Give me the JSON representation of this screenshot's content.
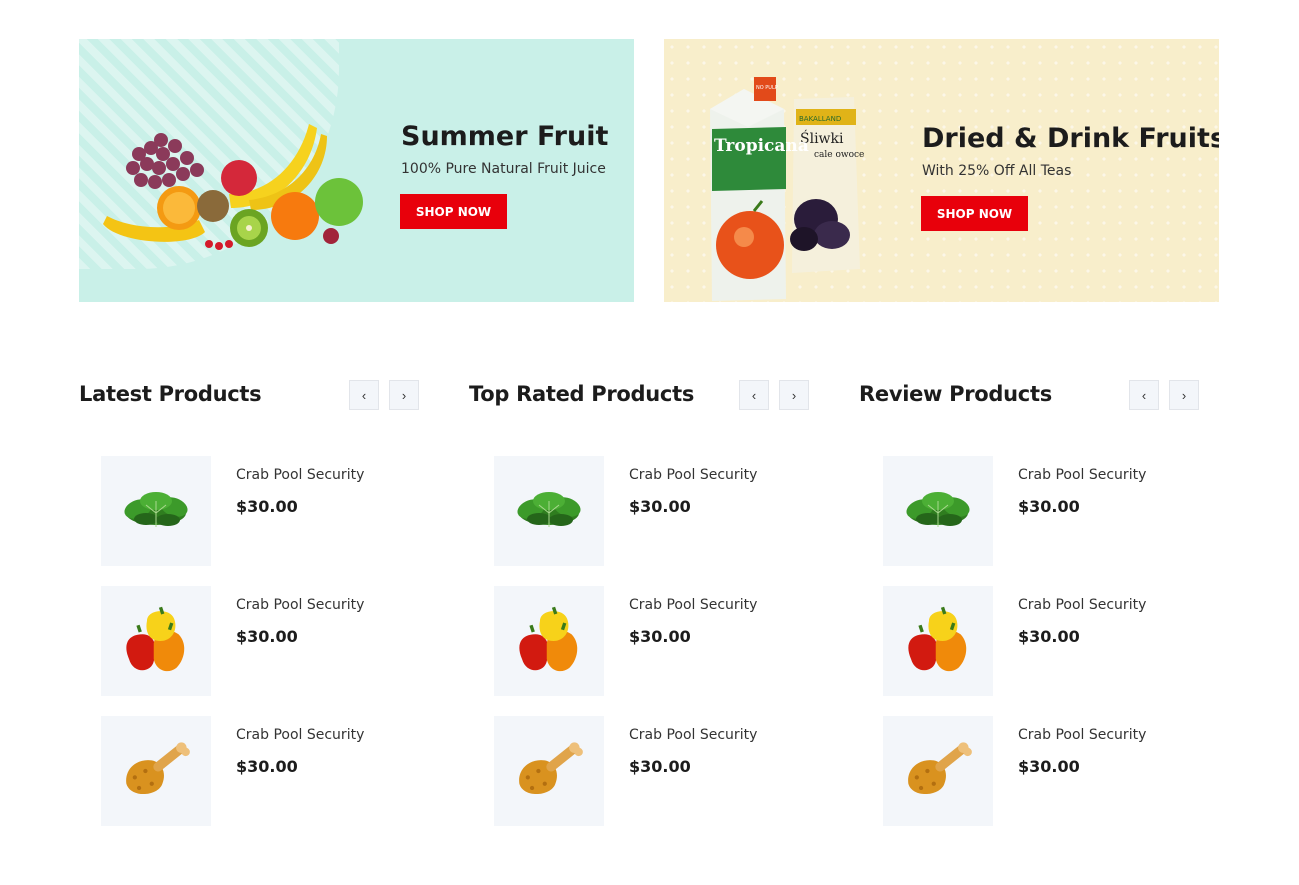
{
  "banners": [
    {
      "title": "Summer Fruit",
      "subtitle": "100% Pure Natural Fruit Juice",
      "button": "SHOP NOW",
      "image": "fruit-basket-image",
      "background": "#c9f0e8"
    },
    {
      "title": "Dried & Drink Fruits",
      "subtitle": "With 25% Off All Teas",
      "button": "SHOP NOW",
      "image": "juice-and-dried-fruit-image",
      "background": "#f8eecb",
      "package_text": {
        "juice_brand": "Tropicana",
        "juice_cap": "NO PULP",
        "bag_brand": "BAKALLAND",
        "bag_title": "Śliwki",
        "bag_sub": "cale owoce"
      }
    }
  ],
  "colors": {
    "accent": "#e8000b",
    "thumb_bg": "#f3f6fa",
    "text": "#1c1c1c"
  },
  "columns": [
    {
      "title": "Latest Products",
      "prev": "‹",
      "next": "›",
      "items": [
        {
          "name": "Crab Pool Security",
          "price": "$30.00",
          "image": "spinach-image"
        },
        {
          "name": "Crab Pool Security",
          "price": "$30.00",
          "image": "bell-peppers-image"
        },
        {
          "name": "Crab Pool Security",
          "price": "$30.00",
          "image": "fried-chicken-image"
        }
      ]
    },
    {
      "title": "Top Rated Products",
      "prev": "‹",
      "next": "›",
      "items": [
        {
          "name": "Crab Pool Security",
          "price": "$30.00",
          "image": "spinach-image"
        },
        {
          "name": "Crab Pool Security",
          "price": "$30.00",
          "image": "bell-peppers-image"
        },
        {
          "name": "Crab Pool Security",
          "price": "$30.00",
          "image": "fried-chicken-image"
        }
      ]
    },
    {
      "title": "Review Products",
      "prev": "‹",
      "next": "›",
      "items": [
        {
          "name": "Crab Pool Security",
          "price": "$30.00",
          "image": "spinach-image"
        },
        {
          "name": "Crab Pool Security",
          "price": "$30.00",
          "image": "bell-peppers-image"
        },
        {
          "name": "Crab Pool Security",
          "price": "$30.00",
          "image": "fried-chicken-image"
        }
      ]
    }
  ]
}
